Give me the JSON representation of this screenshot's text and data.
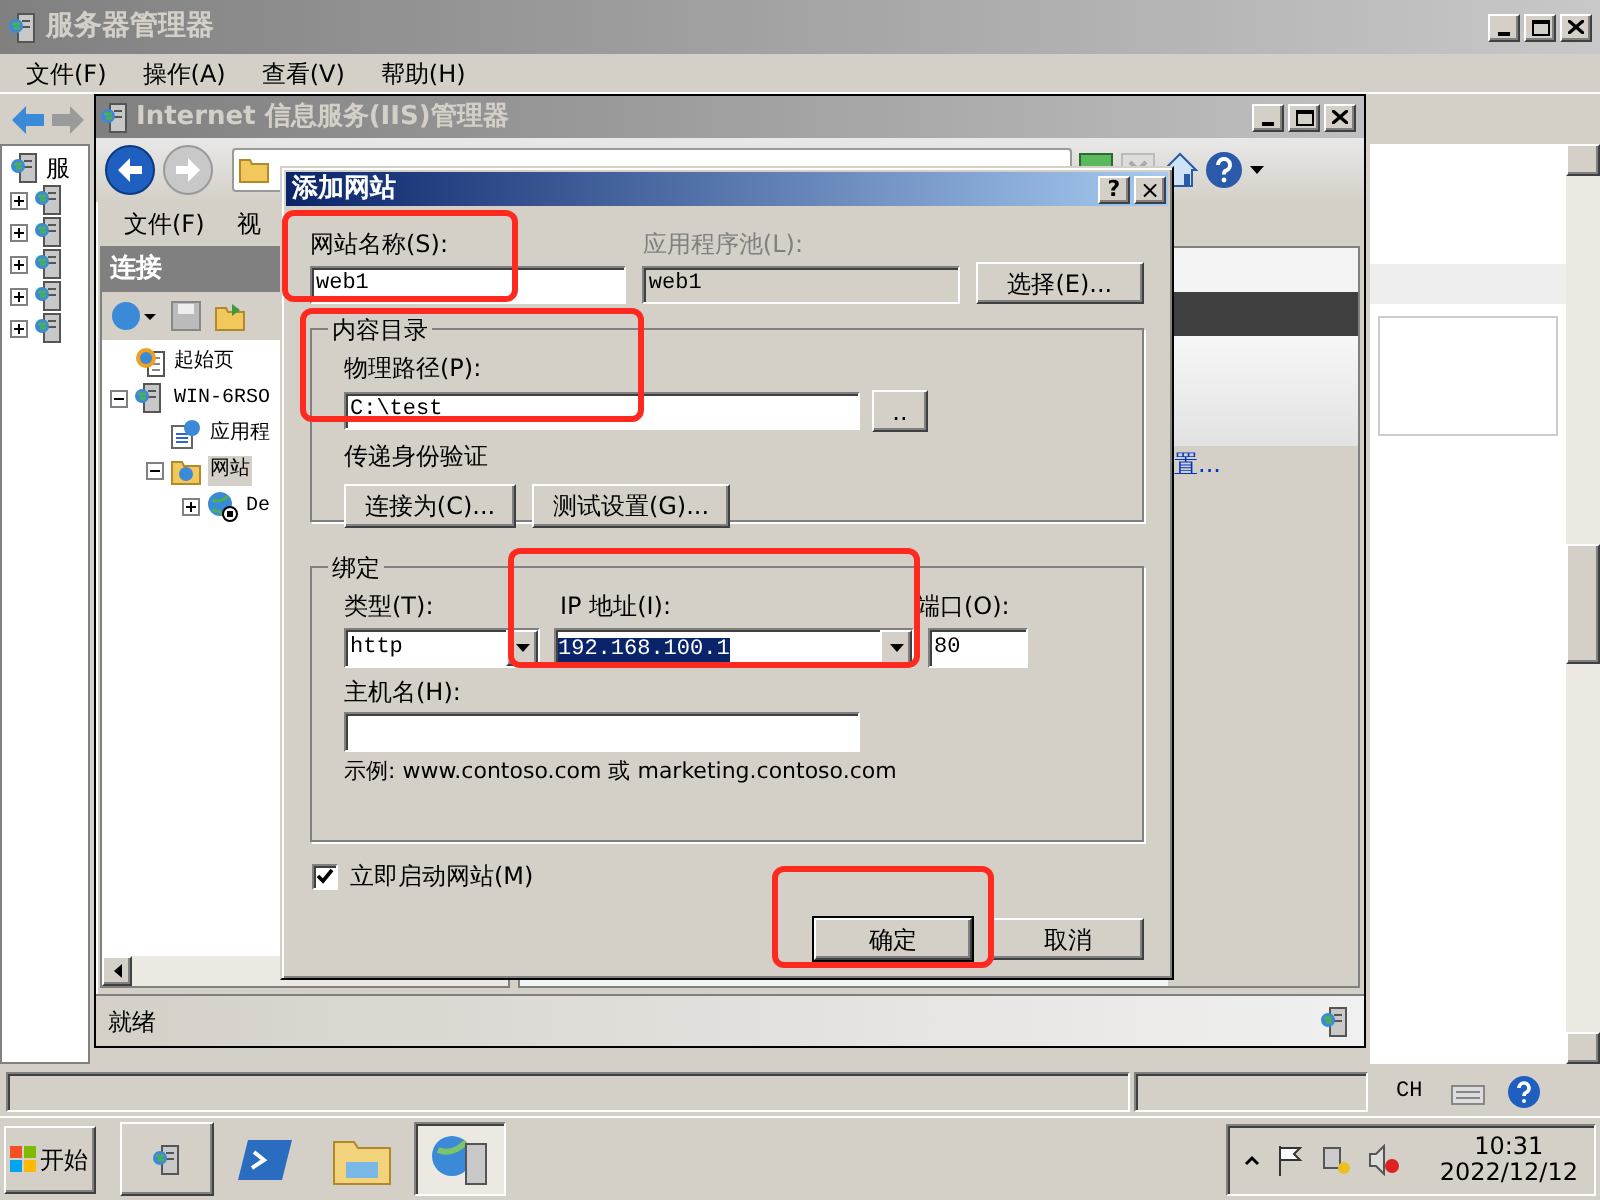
{
  "server_manager": {
    "title": "服务器管理器",
    "menu": [
      "文件(F)",
      "操作(A)",
      "查看(V)",
      "帮助(H)"
    ],
    "tree_root": "服",
    "tree_items": [
      {
        "expanded": false
      },
      {
        "expanded": false
      },
      {
        "expanded": false
      },
      {
        "expanded": false
      },
      {
        "expanded": false
      }
    ]
  },
  "iis": {
    "title": "Internet 信息服务(IIS)管理器",
    "menu": [
      "文件(F)",
      "视"
    ],
    "connections_title": "连接",
    "tree": [
      {
        "label": "起始页",
        "kind": "start"
      },
      {
        "label": "WIN-6RSO",
        "kind": "server",
        "expanded": true,
        "children": [
          {
            "label": "应用程",
            "kind": "pools"
          },
          {
            "label": "网站",
            "kind": "sites",
            "expanded": true,
            "selected": true,
            "children": [
              {
                "label": "De",
                "kind": "site",
                "expanded": false
              }
            ]
          }
        ]
      }
    ],
    "action_link": "置...",
    "status": "就绪"
  },
  "dialog": {
    "title": "添加网站",
    "help": "?",
    "close": "×",
    "site_name_label": "网站名称(S):",
    "site_name": "web1",
    "app_pool_label": "应用程序池(L):",
    "app_pool": "web1",
    "app_pool_disabled": true,
    "select_button": "选择(E)...",
    "content_group": "内容目录",
    "path_label": "物理路径(P):",
    "path": "C:\\test",
    "browse_button": "..",
    "auth_label": "传递身份验证",
    "connect_as_button": "连接为(C)...",
    "test_button": "测试设置(G)...",
    "binding_group": "绑定",
    "type_label": "类型(T):",
    "type": "http",
    "ip_label": "IP 地址(I):",
    "ip": "192.168.100.1",
    "ip_selected": true,
    "port_label": "端口(O):",
    "port": "80",
    "host_label": "主机名(H):",
    "example": "示例: www.contoso.com 或 marketing.contoso.com",
    "start_now": {
      "label": "立即启动网站(M)",
      "checked": true
    },
    "ok_button": "确定",
    "cancel_button": "取消"
  },
  "status_bar": {
    "language": "CH"
  },
  "taskbar": {
    "start": "开始",
    "time": "10:31",
    "date": "2022/12/12"
  }
}
